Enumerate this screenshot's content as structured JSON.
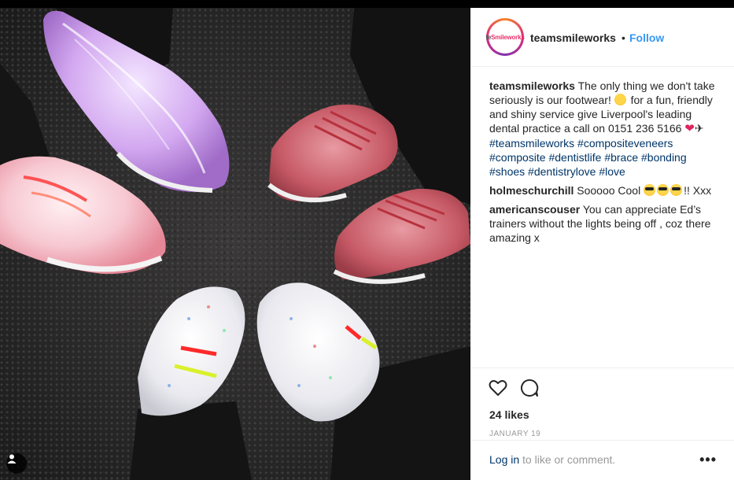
{
  "post": {
    "username": "teamsmileworks",
    "follow_label": "Follow",
    "separator": "•",
    "avatar_brand": "Smileworks",
    "avatar_prefix": "te"
  },
  "comments": [
    {
      "username": "teamsmileworks",
      "part1": "The only thing we don't take seriously is our footwear!",
      "part2": "for a fun, friendly and shiny service give Liverpool's leading dental practice a call on 0151 236 5166",
      "part3": "✈",
      "tags": [
        "#teamsmileworks",
        "#compositeveneers",
        "#composite",
        "#dentistlife",
        "#brace",
        "#bonding",
        "#shoes",
        "#dentistrylove",
        "#love"
      ]
    },
    {
      "username": "holmeschurchill",
      "text_before": "Sooooo Cool",
      "text_after": "!! Xxx"
    },
    {
      "username": "americanscouser",
      "text": "You can appreciate Ed’s trainers without the lights being off , coz there amazing x"
    }
  ],
  "engagement": {
    "likes": "24 likes",
    "date": "January 19"
  },
  "footer": {
    "login_link": "Log in",
    "login_rest": " to like or comment.",
    "more_label": "•••"
  },
  "colors": {
    "follow_blue": "#3897f0",
    "hashtag_blue": "#003569",
    "muted": "#999999"
  },
  "icons": [
    "heart-outline-icon",
    "comment-bubble-icon",
    "user-tag-icon",
    "more-options-icon"
  ]
}
